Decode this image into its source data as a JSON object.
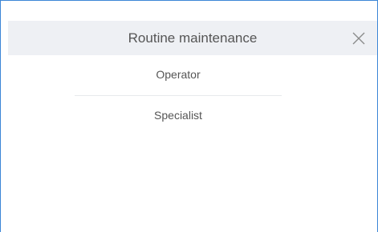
{
  "dialog": {
    "title": "Routine maintenance",
    "close_icon": "close-icon",
    "options": [
      {
        "label": "Operator"
      },
      {
        "label": "Specialist"
      }
    ]
  },
  "colors": {
    "header_bg": "#eef0f4",
    "border": "#3c86d6",
    "text": "#555555"
  }
}
